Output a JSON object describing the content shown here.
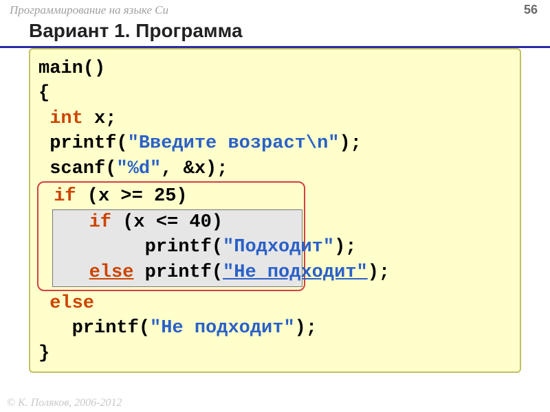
{
  "header": {
    "subject": "Программирование на языке Си",
    "page": "56"
  },
  "title": "Вариант 1. Программа",
  "code": {
    "l1a": "main()",
    "l2a": "{",
    "l3a": " ",
    "l3b": "int",
    "l3c": " x;",
    "l4a": " printf(",
    "l4b": "\"Введите возраст\\n\"",
    "l4c": ");",
    "l5a": " scanf(",
    "l5b": "\"%d\"",
    "l5c": ", &x);",
    "l6a": " ",
    "l6b": "if",
    "l6c": " (x >= 25)",
    "l7a": "   ",
    "l7b": "if",
    "l7c": " (x <= 40)",
    "l8a": "        printf(",
    "l8b": "\"Подходит\"",
    "l8c": ");",
    "l9a": "   ",
    "l9b": "else",
    "l9c": " printf(",
    "l9d": "\"Не подходит\"",
    "l9e": ");",
    "l10a": " ",
    "l10b": "else",
    "l11a": "   printf(",
    "l11b": "\"Не подходит\"",
    "l11c": ");",
    "l12a": "}"
  },
  "footer": "© К. Поляков, 2006-2012"
}
